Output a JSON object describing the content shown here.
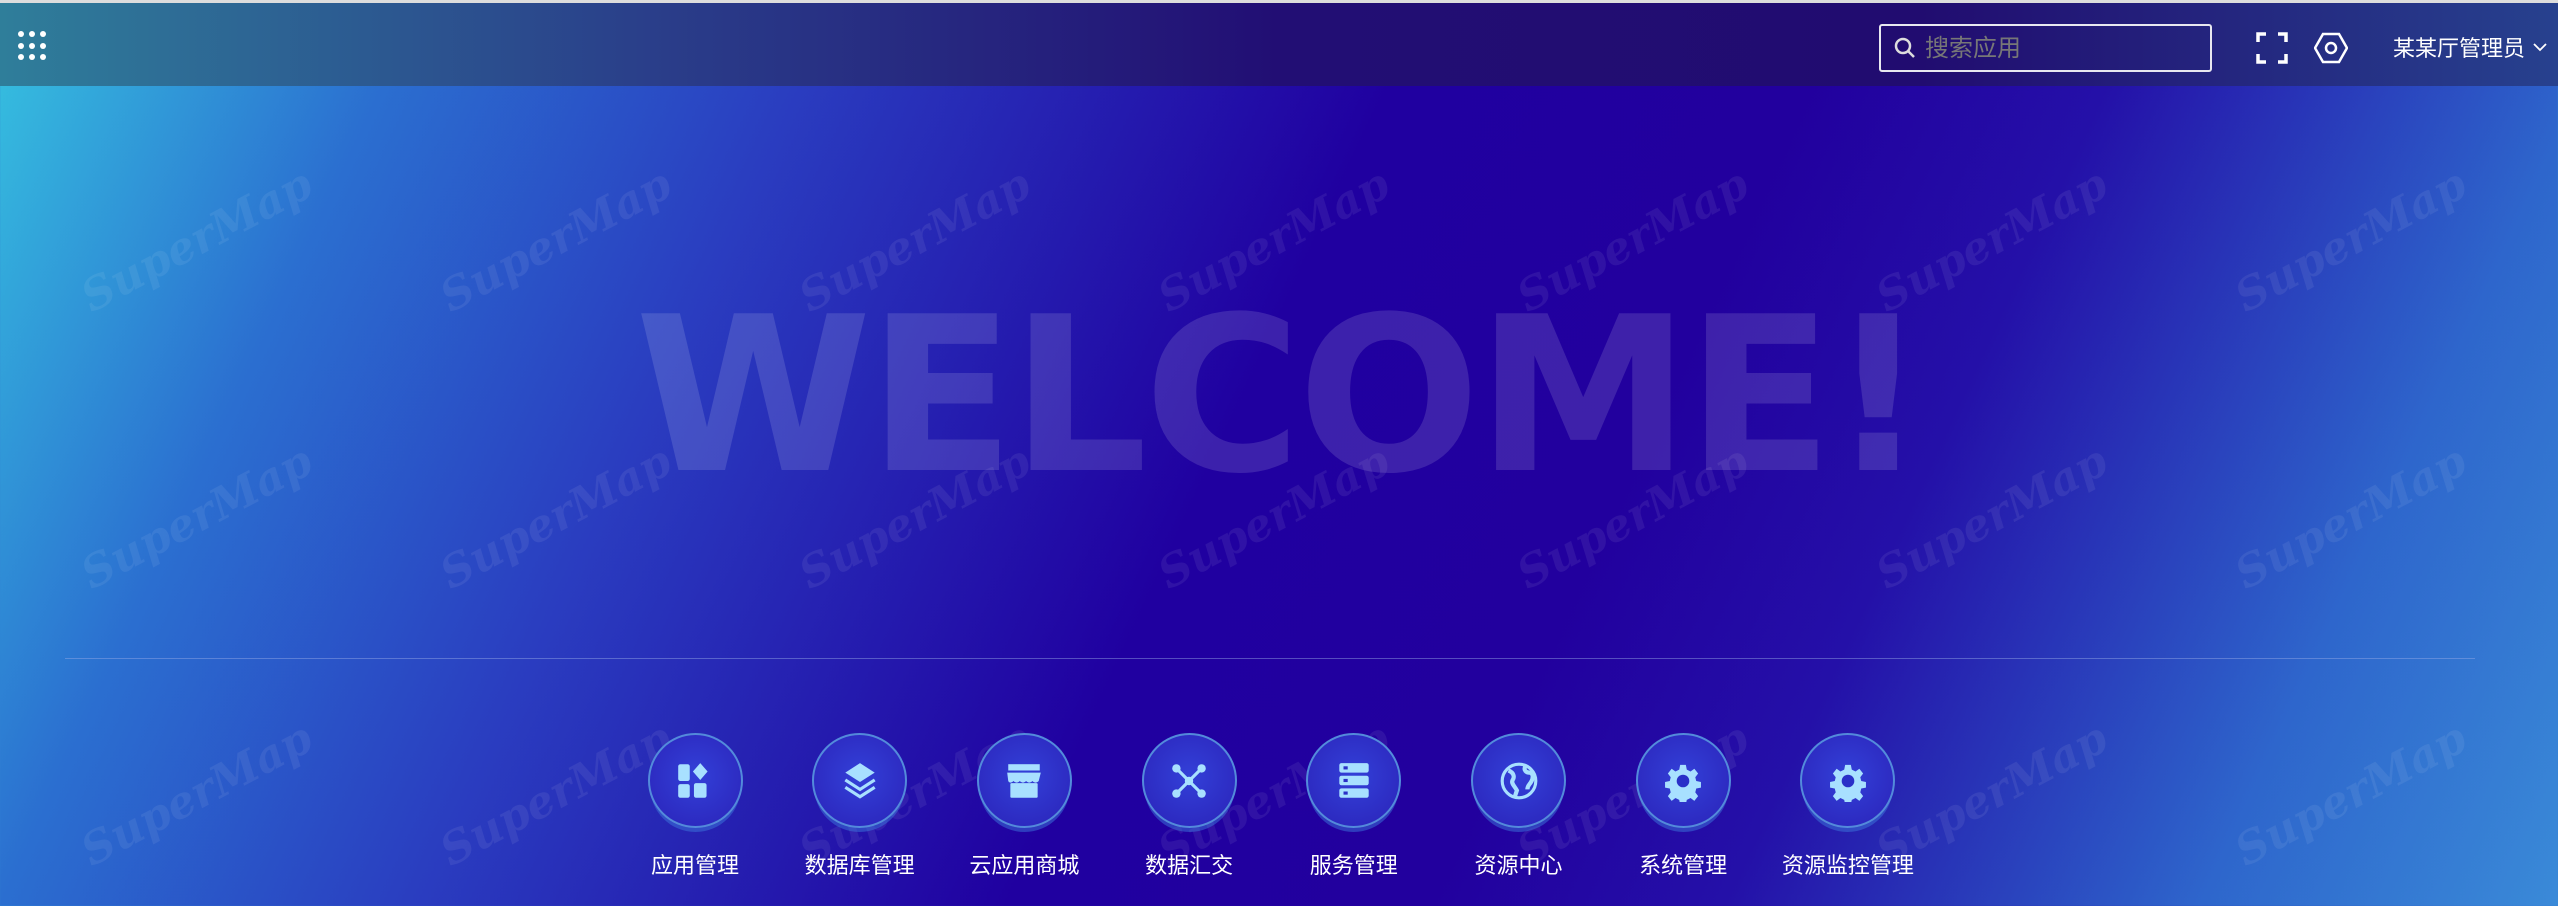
{
  "header": {
    "search_placeholder": "搜索应用",
    "user_name": "某某厅管理员",
    "icons": [
      "apps-grid-icon",
      "search-icon",
      "fullscreen-icon",
      "settings-hex-icon",
      "chevron-down-icon"
    ]
  },
  "watermark": "SuperMap",
  "welcome": "WELCOME!",
  "nav": [
    {
      "label": "应用管理",
      "icon": "apps-icon"
    },
    {
      "label": "数据库管理",
      "icon": "layers-icon"
    },
    {
      "label": "云应用商城",
      "icon": "store-icon"
    },
    {
      "label": "数据汇交",
      "icon": "network-icon"
    },
    {
      "label": "服务管理",
      "icon": "server-icon"
    },
    {
      "label": "资源中心",
      "icon": "globe-icon"
    },
    {
      "label": "系统管理",
      "icon": "gear-icon"
    },
    {
      "label": "资源监控管理",
      "icon": "gear-icon"
    }
  ],
  "colors": {
    "icon": "#a8e0ff",
    "accent": "#2000a0"
  }
}
